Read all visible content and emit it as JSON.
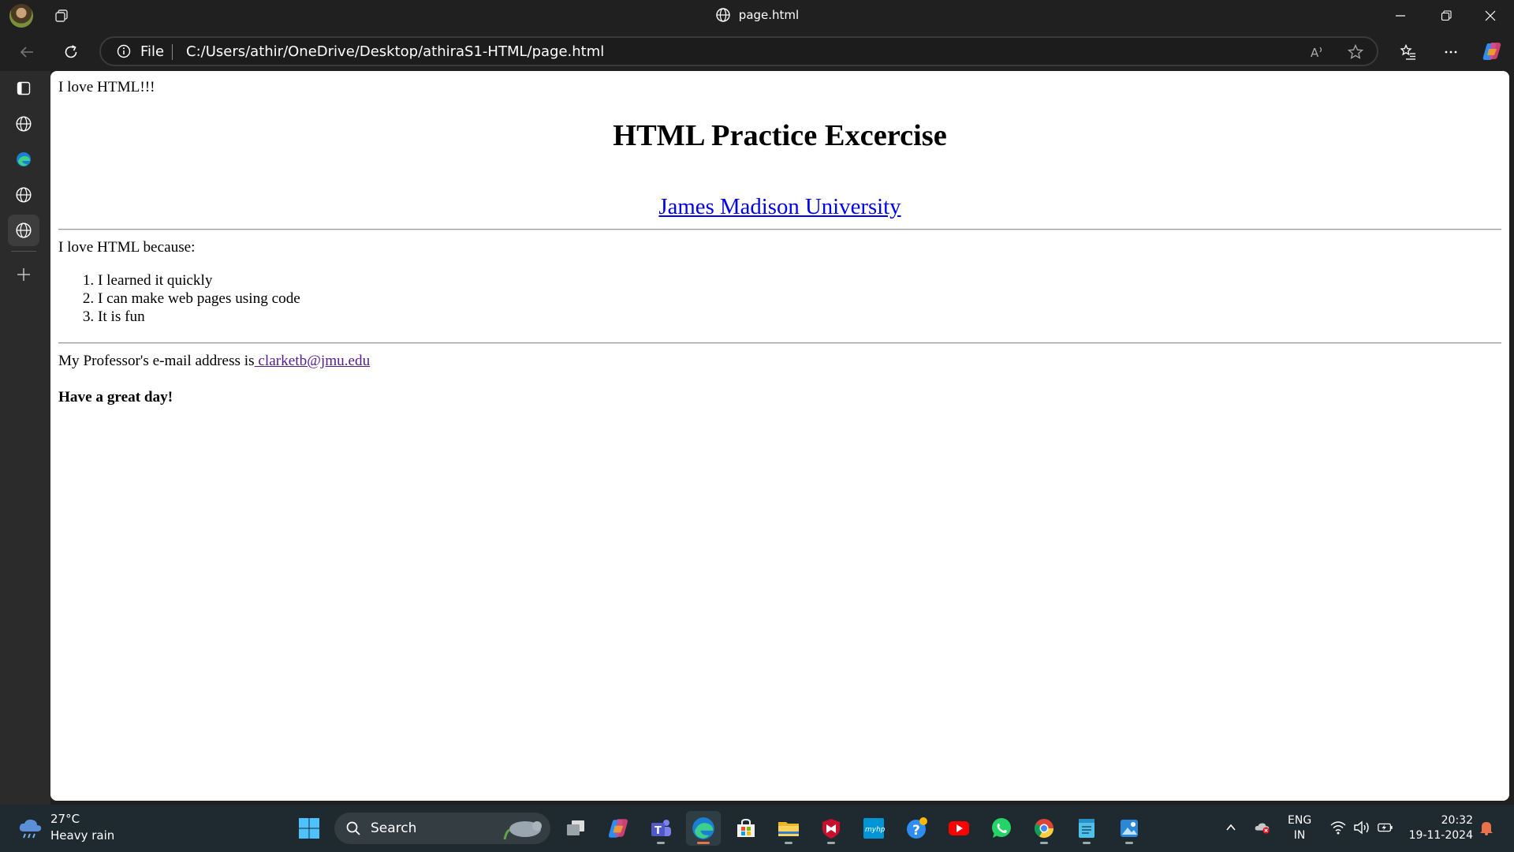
{
  "window": {
    "title": "page.html",
    "profile_icon": "profile-avatar",
    "workspaces_icon": "workspaces-icon",
    "controls": [
      "minimize-icon",
      "restore-icon",
      "close-icon"
    ]
  },
  "address_bar": {
    "site_info_label": "File",
    "url": "C:/Users/athir/OneDrive/Desktop/athiraS1-HTML/page.html",
    "icons": [
      "back-icon",
      "refresh-icon",
      "site-info-icon",
      "read-aloud-icon",
      "favorite-star-icon",
      "favorites-icon",
      "more-icon",
      "copilot-icon"
    ]
  },
  "vertical_tabs": {
    "items": [
      "tab-actions-icon",
      "globe-icon",
      "edge-icon",
      "globe-icon",
      "globe-icon"
    ],
    "new_tab_icon": "plus-icon"
  },
  "page": {
    "intro": "I love HTML!!!",
    "heading": "HTML Practice Excercise",
    "link_text": "James Madison University",
    "because": "I love HTML because:",
    "reasons": [
      "I learned it quickly",
      "I can make web pages using code",
      "It is fun"
    ],
    "professor_text": "My Professor's e-mail address is",
    "email": " clarketb@jmu.edu",
    "closing": "Have a great day!",
    "colors": {
      "link": "#0000ee",
      "visited_link": "#551a8b"
    }
  },
  "taskbar": {
    "weather": {
      "temp": "27°C",
      "condition": "Heavy rain"
    },
    "search_label": "Search",
    "apps": [
      "windows-start-icon",
      "search-icon",
      "task-view-icon",
      "copilot-icon",
      "teams-icon",
      "edge-icon",
      "store-icon",
      "file-explorer-icon",
      "mcafee-icon",
      "myhp-icon",
      "help-icon",
      "youtube-icon",
      "whatsapp-icon",
      "chrome-icon",
      "notepad-icon",
      "photos-icon"
    ],
    "tray": {
      "language_line1": "ENG",
      "language_line2": "IN",
      "time": "20:32",
      "date": "19-11-2024"
    }
  }
}
